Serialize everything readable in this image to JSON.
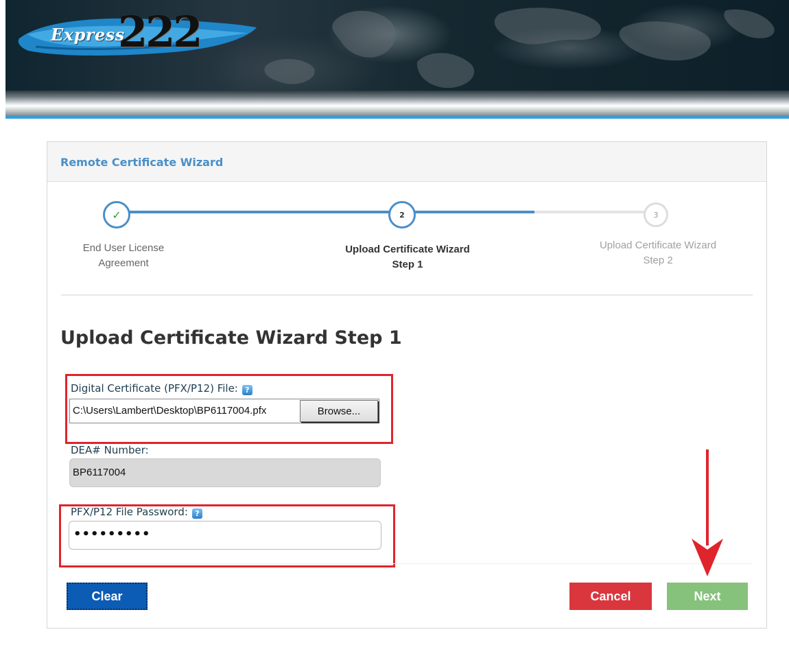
{
  "banner": {
    "logo_express": "Express",
    "logo_number": "222"
  },
  "wizard": {
    "title": "Remote Certificate Wizard",
    "steps": [
      {
        "number": "✓",
        "label": "End User License Agreement",
        "state": "completed"
      },
      {
        "number": "2",
        "label": "Upload Certificate Wizard Step 1",
        "state": "active"
      },
      {
        "number": "3",
        "label": "Upload Certificate Wizard Step 2",
        "state": "pending"
      }
    ]
  },
  "form": {
    "heading": "Upload Certificate Wizard Step 1",
    "certificate": {
      "label": "Digital Certificate (PFX/P12) File:",
      "value": "C:\\Users\\Lambert\\Desktop\\BP6117004.pfx",
      "browse_label": "Browse..."
    },
    "dea": {
      "label": "DEA# Number:",
      "value": "BP6117004"
    },
    "password": {
      "label": "PFX/P12 File Password:",
      "masked_value": "•••••••••"
    },
    "help_icon": "?"
  },
  "buttons": {
    "clear": "Clear",
    "cancel": "Cancel",
    "next": "Next"
  },
  "colors": {
    "accent_blue": "#4a8fc8",
    "highlight_red": "#e0242c",
    "clear_button": "#0c5bb5",
    "cancel_button": "#d9363e",
    "next_button": "#86c27c"
  }
}
